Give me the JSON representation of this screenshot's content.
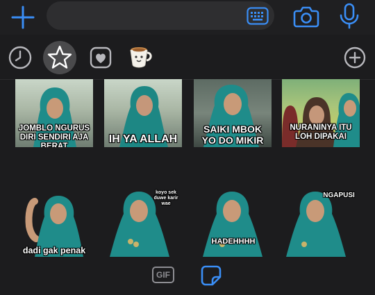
{
  "top_bar": {
    "plus_icon": "plus-icon",
    "message_field_value": "",
    "keyboard_icon": "keyboard-icon",
    "camera_icon": "camera-icon",
    "mic_icon": "microphone-icon",
    "accent_color": "#3a8ef6"
  },
  "sticker_tray": {
    "tabs": [
      {
        "icon": "recent-clock-icon",
        "selected": false
      },
      {
        "icon": "favorites-star-icon",
        "selected": true
      },
      {
        "icon": "heart-icon",
        "selected": false
      },
      {
        "icon": "coffee-cup-pack-icon",
        "selected": false
      }
    ],
    "add_icon": "add-pack-icon"
  },
  "stickers": [
    {
      "caption": "JOMBLO NGURUS DIRI SENDIRI AJA BERAT"
    },
    {
      "caption": "IH YA ALLAH"
    },
    {
      "caption": "SAIKI MBOK YO DO MIKIR"
    },
    {
      "caption": "NURANINYA ITU LOH DIPAKAI"
    },
    {
      "caption": "dadi gak penak"
    },
    {
      "caption": "koyo sek duwe karir wae"
    },
    {
      "caption": "HADEHHHH"
    },
    {
      "caption": "NGAPUSI"
    }
  ],
  "bottom_bar": {
    "gif_label": "GIF",
    "sticker_icon": "sticker-icon"
  }
}
